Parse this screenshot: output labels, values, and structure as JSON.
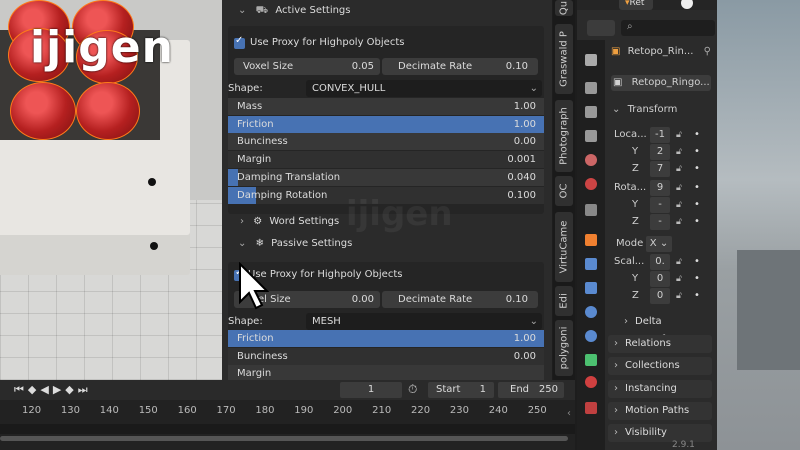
{
  "brand": {
    "logo_text": "ijigen",
    "watermark": "ijigen"
  },
  "physics_panel": {
    "active_header": "Active Settings",
    "active": {
      "use_proxy_label": "Use Proxy for Highpoly Objects",
      "voxel_size_label": "Voxel Size",
      "voxel_size_value": "0.05",
      "decimate_rate_label": "Decimate Rate",
      "decimate_rate_value": "0.10",
      "shape_label": "Shape:",
      "shape_value": "CONVEX_HULL",
      "properties": [
        {
          "label": "Mass",
          "value": "1.00"
        },
        {
          "label": "Friction",
          "value": "1.00"
        },
        {
          "label": "Bunciness",
          "value": "0.00"
        },
        {
          "label": "Margin",
          "value": "0.001"
        },
        {
          "label": "Damping Translation",
          "value": "0.040"
        },
        {
          "label": "Damping  Rotation",
          "value": "0.100"
        }
      ]
    },
    "word_settings_header": "Word Settings",
    "passive_header": "Passive Settings",
    "passive": {
      "use_proxy_label": "Use Proxy for Highpoly Objects",
      "voxel_size_label": "el Size",
      "voxel_size_value": "0.00",
      "decimate_rate_label": "Decimate Rate",
      "decimate_rate_value": "0.10",
      "shape_label": "Shape:",
      "shape_value": "MESH",
      "properties": [
        {
          "label": "Friction",
          "value": "1.00"
        },
        {
          "label": "Bunciness",
          "value": "0.00"
        },
        {
          "label": "Margin",
          "value": ""
        }
      ]
    }
  },
  "side_tabs": [
    "Qu",
    "Graswald P",
    "Photograph",
    "OC",
    "VirtuCame",
    "Edi",
    "polygoni"
  ],
  "timeline": {
    "current_frame": "1",
    "start_label": "Start",
    "start_value": "1",
    "end_label": "End",
    "end_value": "250",
    "ticks": [
      "120",
      "130",
      "140",
      "150",
      "160",
      "170",
      "180",
      "190",
      "200",
      "210",
      "220",
      "230",
      "240",
      "250"
    ]
  },
  "object_props": {
    "header_tag": "Ret",
    "object_name": "Retopo_Rin...",
    "data_name": "Retopo_Ringo...",
    "transform_header": "Transform",
    "location_label": "Loca...",
    "location": {
      "x": "-1",
      "y": "2",
      "z": "7"
    },
    "rotation_label": "Rota...",
    "rotation": {
      "x": "9",
      "y": "-",
      "z": "-"
    },
    "mode_label": "Mode",
    "mode_value": "X",
    "scale_label": "Scal...",
    "scale": {
      "x": "0.",
      "y": "0",
      "z": "0"
    },
    "axis_labels": {
      "y": "Y",
      "z": "Z"
    },
    "sections": [
      "Delta Transform",
      "Relations",
      "Collections",
      "Instancing",
      "Motion Paths",
      "Visibility"
    ],
    "version": "2.9.1"
  },
  "colors": {
    "accent": "#4772b3",
    "panel": "#2b2b2b",
    "field": "#3c3c3c"
  }
}
